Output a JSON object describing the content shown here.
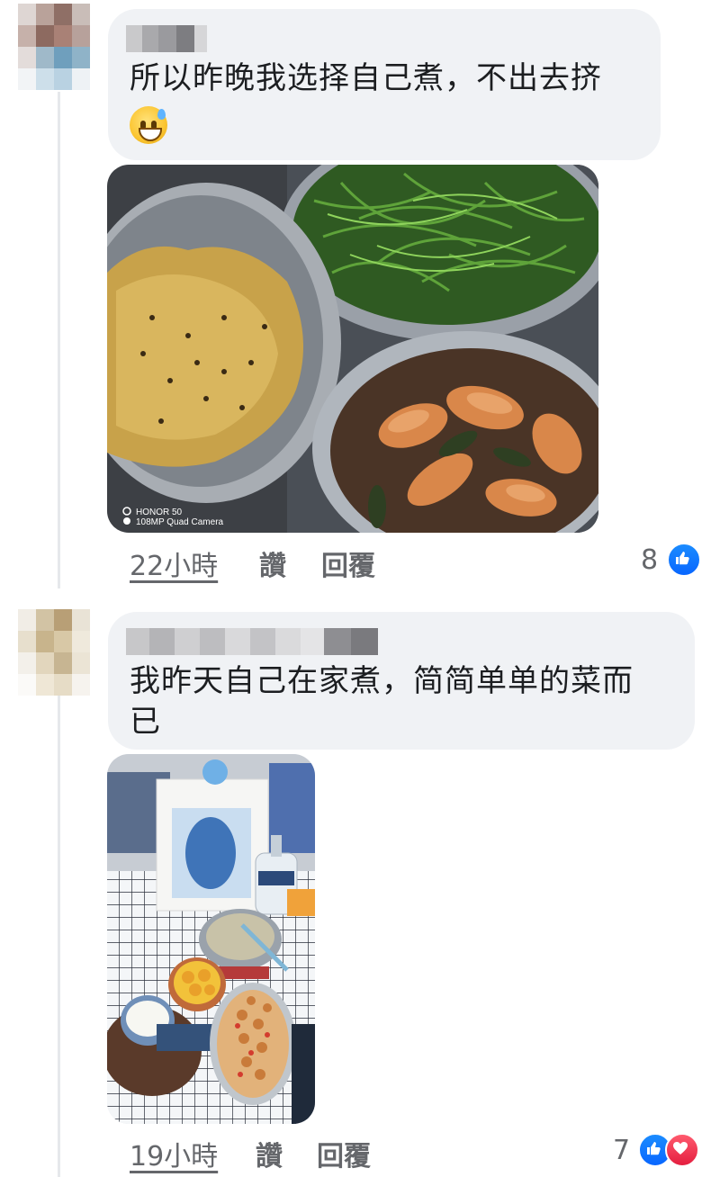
{
  "comments": [
    {
      "text": "所以昨晚我选择自己煮，不出去挤",
      "emoji": "sweat-smile-emoji",
      "image_watermark": [
        "HONOR 50",
        "108MP Quad Camera"
      ],
      "time": "22小時",
      "like_label": "讚",
      "reply_label": "回覆",
      "reaction_count": "8",
      "reactions": [
        "like-icon"
      ]
    },
    {
      "text_line1": "我昨天自己在家煮，简简单单的菜而",
      "text_line2": "已",
      "time": "19小時",
      "like_label": "讚",
      "reply_label": "回覆",
      "reaction_count": "7",
      "reactions": [
        "like-icon",
        "love-icon"
      ]
    }
  ],
  "colors": {
    "bubble_bg": "#f0f2f5",
    "meta_text": "#65676b",
    "like_blue": "#0866ff",
    "love_red": "#e41e3f"
  }
}
